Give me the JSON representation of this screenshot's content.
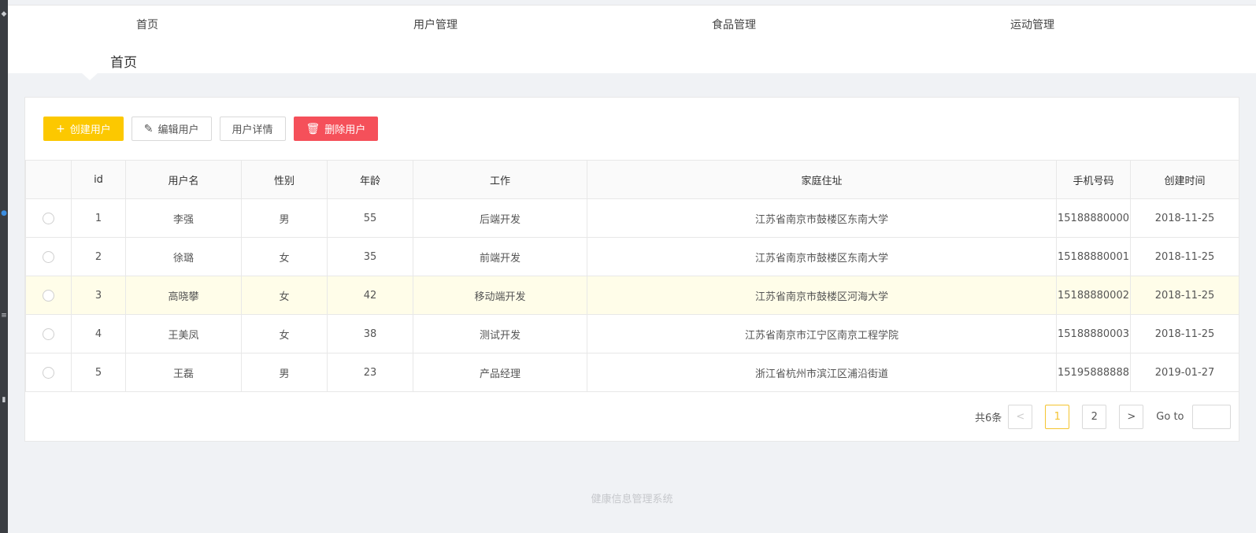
{
  "nav": {
    "items": [
      {
        "label": "首页"
      },
      {
        "label": "用户管理"
      },
      {
        "label": "食品管理"
      },
      {
        "label": "运动管理"
      }
    ]
  },
  "breadcrumb": {
    "current": "首页"
  },
  "toolbar": {
    "create_label": "创建用户",
    "edit_label": "编辑用户",
    "detail_label": "用户详情",
    "delete_label": "删除用户"
  },
  "table": {
    "headers": [
      "id",
      "用户名",
      "性别",
      "年龄",
      "工作",
      "家庭住址",
      "手机号码",
      "创建时间"
    ],
    "rows": [
      [
        "1",
        "李强",
        "男",
        "55",
        "后端开发",
        "江苏省南京市鼓楼区东南大学",
        "15188880000",
        "2018-11-25"
      ],
      [
        "2",
        "徐璐",
        "女",
        "35",
        "前端开发",
        "江苏省南京市鼓楼区东南大学",
        "15188880001",
        "2018-11-25"
      ],
      [
        "3",
        "高晓攀",
        "女",
        "42",
        "移动端开发",
        "江苏省南京市鼓楼区河海大学",
        "15188880002",
        "2018-11-25"
      ],
      [
        "4",
        "王美凤",
        "女",
        "38",
        "测试开发",
        "江苏省南京市江宁区南京工程学院",
        "15188880003",
        "2018-11-25"
      ],
      [
        "5",
        "王磊",
        "男",
        "23",
        "产品经理",
        "浙江省杭州市滨江区浦沿街道",
        "15195888888",
        "2019-01-27"
      ]
    ],
    "highlighted_row": 3
  },
  "pagination": {
    "total": "共6条",
    "prev": "<",
    "pages": [
      "1",
      "2"
    ],
    "current": "1",
    "next": ">",
    "goto_label": "Go to",
    "goto_value": ""
  },
  "footer": {
    "text": "健康信息管理系统"
  },
  "colors": {
    "accent": "#fcc800",
    "danger": "#f5505a",
    "highlight_row": "#fffde9"
  },
  "icons": {
    "create": "plus-icon",
    "edit": "pencil-icon",
    "delete": "trash-icon",
    "prev": "chevron-left-icon",
    "next": "chevron-right-icon"
  }
}
